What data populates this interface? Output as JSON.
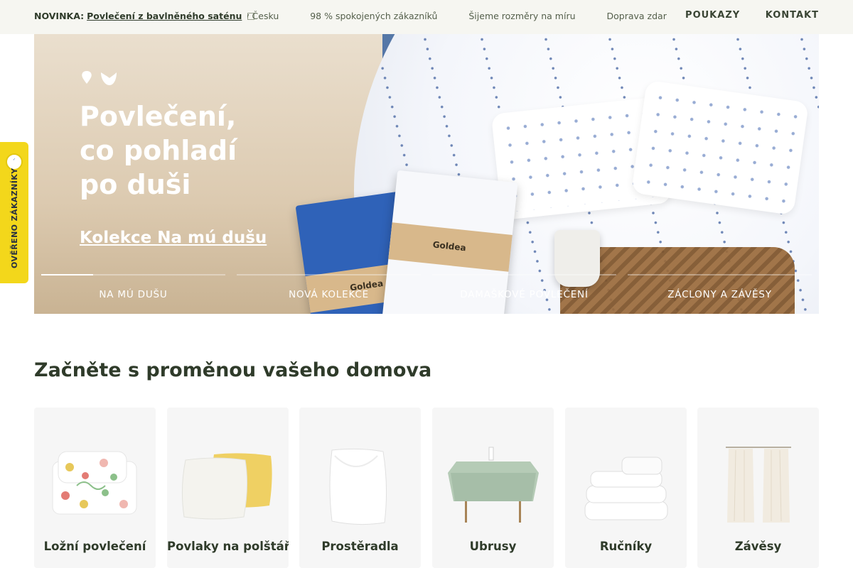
{
  "topbar": {
    "promo_prefix": "NOVINKA:",
    "promo_link": "Povlečení z bavlněného saténu",
    "marquee": [
      "beno v Česku",
      "98 % spokojených zákazníků",
      "Šijeme rozměry na míru",
      "Doprava zdar"
    ],
    "nav": [
      "POUKAZY",
      "KONTAKT"
    ]
  },
  "hero": {
    "title_lines": [
      "Povlečení,",
      "co pohladí",
      "po duši"
    ],
    "link": "Kolekce Na mú dušu",
    "pack_brand": "Goldea",
    "tabs": [
      {
        "label": "NA MÚ DUŠU",
        "progress": 0.28
      },
      {
        "label": "NOVÁ KOLEKCE",
        "progress": 0
      },
      {
        "label": "DAMAŠKOVÉ POVLEČENÍ",
        "progress": 0
      },
      {
        "label": "ZÁCLONY A ZÁVĚSY",
        "progress": 0
      }
    ]
  },
  "badge": {
    "label": "OVĚŘENO ZÁKAZNÍKY"
  },
  "section": {
    "title_regular": "Začněte s proměnou ",
    "title_bold": "vašeho domova"
  },
  "categories": [
    {
      "name": "Ložní povlečení",
      "icon": "bedding-icon"
    },
    {
      "name": "Povlaky na polštáře",
      "icon": "pillowcase-icon"
    },
    {
      "name": "Prostěradla",
      "icon": "sheet-icon"
    },
    {
      "name": "Ubrusy",
      "icon": "tablecloth-icon"
    },
    {
      "name": "Ručníky",
      "icon": "towels-icon"
    },
    {
      "name": "Závěsy",
      "icon": "curtains-icon"
    }
  ],
  "colors": {
    "accent": "#f3d71b",
    "text": "#2f3b2a",
    "topbar_bg": "#f6f6f1",
    "card_bg": "#f6f6f6"
  }
}
